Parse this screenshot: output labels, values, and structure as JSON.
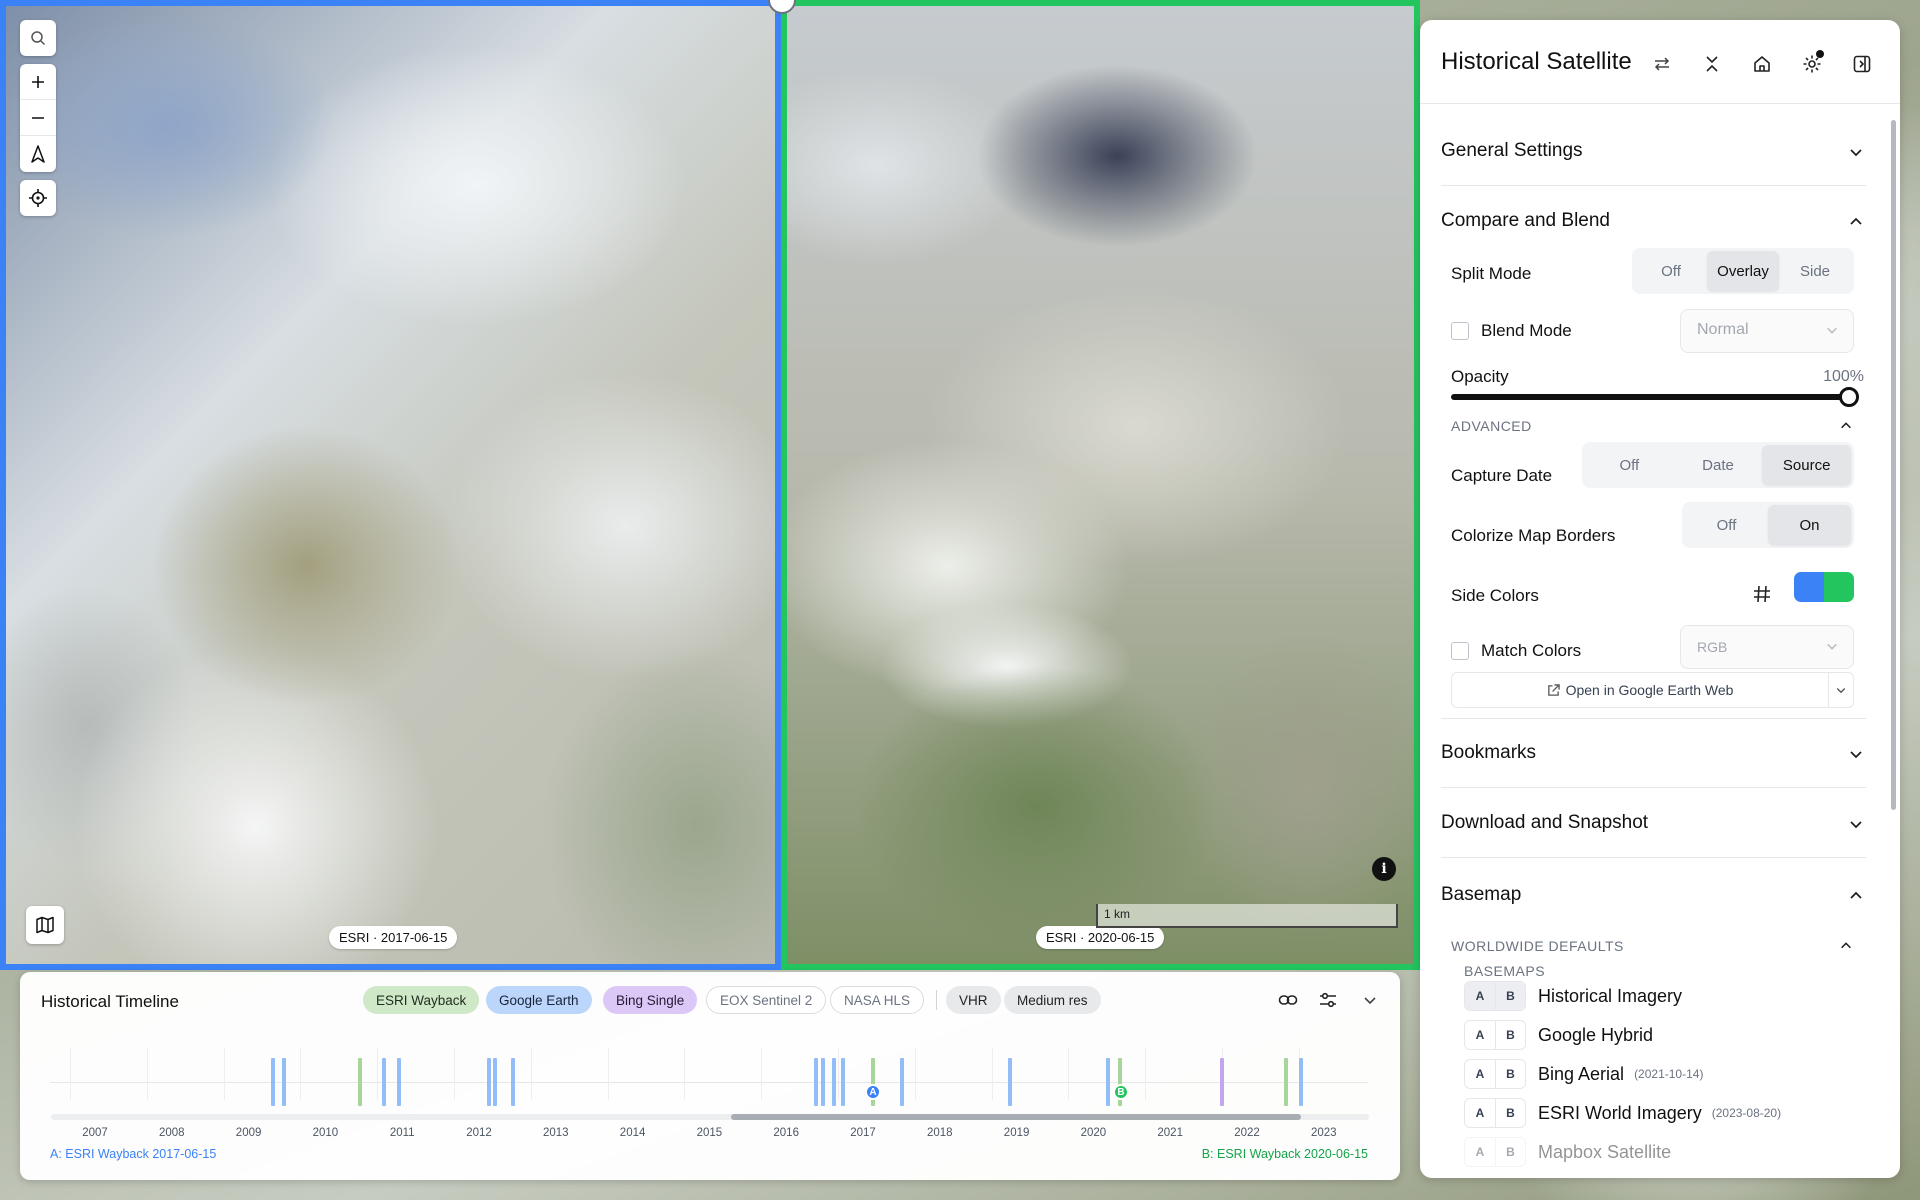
{
  "map": {
    "date_a": "ESRI · 2017-06-15",
    "date_b": "ESRI · 2020-06-15",
    "scale": "1 km",
    "border_colors": {
      "a": "#3b82f6",
      "b": "#22c55e"
    }
  },
  "timeline": {
    "title": "Historical Timeline",
    "chips": {
      "esri": "ESRI Wayback",
      "google": "Google Earth",
      "bing": "Bing Single",
      "eox": "EOX Sentinel 2",
      "nasa": "NASA HLS",
      "vhr": "VHR",
      "medium": "Medium res"
    },
    "years": [
      "2007",
      "2008",
      "2009",
      "2010",
      "2011",
      "2012",
      "2013",
      "2014",
      "2015",
      "2016",
      "2017",
      "2018",
      "2019",
      "2020",
      "2021",
      "2022",
      "2023"
    ],
    "marker_a": "A",
    "marker_b": "B",
    "selection_a": "A: ESRI Wayback 2017-06-15",
    "selection_b": "B: ESRI Wayback 2020-06-15",
    "colors": {
      "esri": "#a7d59a",
      "google": "#93bdf7",
      "bing": "#c3a6ef"
    }
  },
  "panel": {
    "title": "Historical Satellite",
    "sections": {
      "general": "General Settings",
      "compare": "Compare and Blend",
      "bookmarks": "Bookmarks",
      "download": "Download and Snapshot",
      "basemap": "Basemap"
    },
    "compare": {
      "split_mode_label": "Split Mode",
      "split_options": [
        "Off",
        "Overlay",
        "Side"
      ],
      "blend_mode_label": "Blend Mode",
      "blend_mode_value": "Normal",
      "opacity_label": "Opacity",
      "opacity_value": "100%",
      "opacity_fraction": 1.0,
      "advanced_label": "ADVANCED",
      "capture_date_label": "Capture Date",
      "capture_options": [
        "Off",
        "Date",
        "Source"
      ],
      "colorize_label": "Colorize Map Borders",
      "colorize_options": [
        "Off",
        "On"
      ],
      "side_colors_label": "Side Colors",
      "match_colors_label": "Match Colors",
      "match_colors_value": "RGB",
      "google_earth_button": "Open in Google Earth Web"
    },
    "basemap": {
      "worldwide_label": "WORLDWIDE DEFAULTS",
      "basemaps_label": "BASEMAPS",
      "items": [
        {
          "a": "A",
          "b": "B",
          "name": "Historical Imagery",
          "date": ""
        },
        {
          "a": "A",
          "b": "B",
          "name": "Google Hybrid",
          "date": ""
        },
        {
          "a": "A",
          "b": "B",
          "name": "Bing Aerial",
          "date": "(2021-10-14)"
        },
        {
          "a": "A",
          "b": "B",
          "name": "ESRI World Imagery",
          "date": "(2023-08-20)"
        },
        {
          "a": "A",
          "b": "B",
          "name": "Mapbox Satellite",
          "date": ""
        }
      ]
    }
  }
}
